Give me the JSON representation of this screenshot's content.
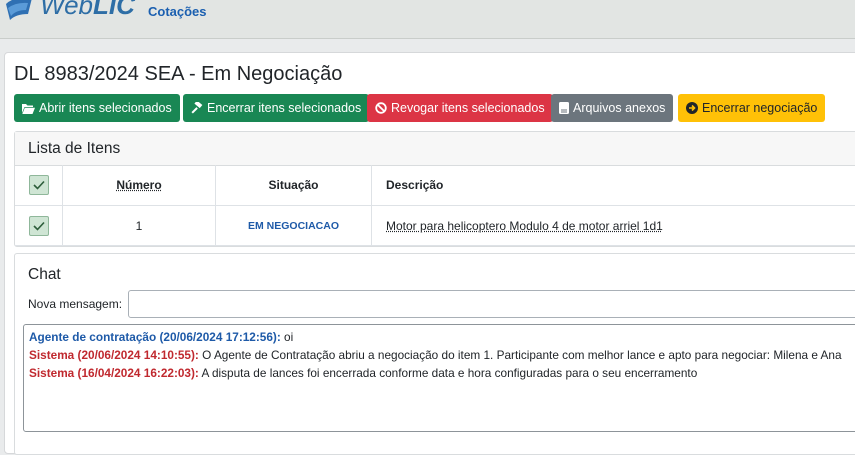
{
  "app": {
    "logo_text_light": "Web",
    "logo_text_bold": "LIC",
    "nav_link": "Cotações"
  },
  "page": {
    "title": "DL 8983/2024 SEA - Em Negociação"
  },
  "actions": [
    {
      "label": "Abrir itens selecionados",
      "icon": "folder-open-icon",
      "color": "#198754"
    },
    {
      "label": "Encerrar itens selecionados",
      "icon": "gavel-icon",
      "color": "#198754"
    },
    {
      "label": "Revogar itens selecionados",
      "icon": "ban-icon",
      "color": "#dc3545"
    },
    {
      "label": "Arquivos anexos",
      "icon": "file-icon",
      "color": "#6c757d"
    },
    {
      "label": "Encerrar negociação",
      "icon": "arrow-circle-icon",
      "color": "#ffc107"
    }
  ],
  "items_list": {
    "title": "Lista de Itens",
    "columns": {
      "number": "Número",
      "status": "Situação",
      "description": "Descrição"
    },
    "select_all_checked": true,
    "rows": [
      {
        "checked": true,
        "number": "1",
        "status": "EM NEGOCIACAO",
        "description": "Motor para helicoptero Modulo 4 de motor arriel 1d1"
      }
    ]
  },
  "chat": {
    "title": "Chat",
    "new_message_label": "Nova mensagem:",
    "new_message_value": "",
    "messages": [
      {
        "sender": "Agente de contratação (20/06/2024 17:12:56):",
        "text": " oi",
        "type": "agent"
      },
      {
        "sender": "Sistema (20/06/2024 14:10:55):",
        "text": " O Agente de Contratação abriu a negociação do item 1. Participante com melhor lance e apto para negociar: Milena e Ana",
        "type": "system"
      },
      {
        "sender": "Sistema (16/04/2024 16:22:03):",
        "text": " A disputa de lances foi encerrada conforme data e hora configuradas para o seu encerramento",
        "type": "system"
      }
    ]
  }
}
